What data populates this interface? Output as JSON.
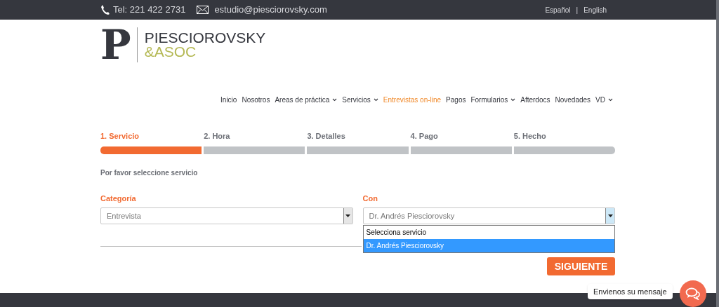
{
  "top_bar": {
    "phone": "Tel: 221 422 2731",
    "email": "estudio@piesciorovsky.com",
    "languages": [
      {
        "label": "Español"
      },
      {
        "label": "English"
      }
    ],
    "separator": "|"
  },
  "logo": {
    "mark": "P",
    "name": "PIESCIOROVSKY",
    "suffix": "&ASOC"
  },
  "nav": [
    {
      "label": "Inicio",
      "selected": false,
      "dropdown": false
    },
    {
      "label": "Nosotros",
      "selected": false,
      "dropdown": false
    },
    {
      "label": "Areas de práctica",
      "selected": false,
      "dropdown": true
    },
    {
      "label": "Servicios",
      "selected": false,
      "dropdown": true
    },
    {
      "label": "Entrevistas on-line",
      "selected": true,
      "dropdown": false
    },
    {
      "label": "Pagos",
      "selected": false,
      "dropdown": false
    },
    {
      "label": "Formularios",
      "selected": false,
      "dropdown": true
    },
    {
      "label": "Afterdocs",
      "selected": false,
      "dropdown": false
    },
    {
      "label": "Novedades",
      "selected": false,
      "dropdown": false
    },
    {
      "label": "VD",
      "selected": false,
      "dropdown": true
    }
  ],
  "steps": [
    {
      "label": "1. Servicio",
      "selected": true
    },
    {
      "label": "2. Hora",
      "selected": false
    },
    {
      "label": "3. Detalles",
      "selected": false
    },
    {
      "label": "4. Pago",
      "selected": false
    },
    {
      "label": "5. Hecho",
      "selected": false
    }
  ],
  "prompt": "Por favor seleccione servicio",
  "fields": [
    {
      "label": "Categoría",
      "value": "Entrevista",
      "expanded": false
    },
    {
      "label": "Con",
      "value": "Dr. Andrés Piesciorovsky",
      "expanded": true,
      "options": [
        {
          "label": "Selecciona servicio",
          "selected": false
        },
        {
          "label": "Dr. Andrés Piesciorovsky",
          "selected": true
        }
      ]
    }
  ],
  "next_button": "SIGUIENTE",
  "chat": {
    "label": "Envienos su mensaje"
  }
}
